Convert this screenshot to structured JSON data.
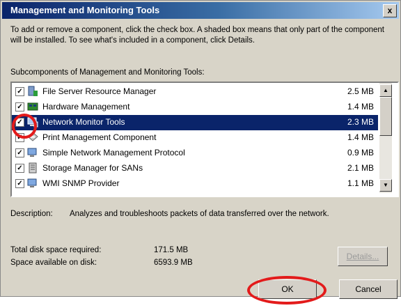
{
  "window": {
    "title": "Management and Monitoring Tools",
    "close_label": "x"
  },
  "intro_text": "To add or remove a component, click the check box. A shaded box means that only part of the component will be installed. To see what's included in a component, click Details.",
  "list_label": "Subcomponents of Management and Monitoring Tools:",
  "components": [
    {
      "name": "File Server Resource Manager",
      "size": "2.5 MB",
      "checked": true,
      "selected": false,
      "icon": "server-icon"
    },
    {
      "name": "Hardware Management",
      "size": "1.4 MB",
      "checked": true,
      "selected": false,
      "icon": "hardware-icon"
    },
    {
      "name": "Network Monitor Tools",
      "size": "2.3 MB",
      "checked": true,
      "selected": true,
      "icon": "network-monitor-icon"
    },
    {
      "name": "Print Management Component",
      "size": "1.4 MB",
      "checked": true,
      "selected": false,
      "icon": "printer-icon"
    },
    {
      "name": "Simple Network Management Protocol",
      "size": "0.9 MB",
      "checked": true,
      "selected": false,
      "icon": "computer-icon"
    },
    {
      "name": "Storage Manager for SANs",
      "size": "2.1 MB",
      "checked": true,
      "selected": false,
      "icon": "storage-icon"
    },
    {
      "name": "WMI SNMP Provider",
      "size": "1.1 MB",
      "checked": true,
      "selected": false,
      "icon": "computer-icon"
    }
  ],
  "description": {
    "label": "Description:",
    "text": "Analyzes and troubleshoots packets of data transferred over the network."
  },
  "disk": {
    "total_label": "Total disk space required:",
    "total_value": "171.5 MB",
    "available_label": "Space available on disk:",
    "available_value": "6593.9 MB"
  },
  "buttons": {
    "details": "Details...",
    "ok": "OK",
    "cancel": "Cancel"
  },
  "colors": {
    "title_bar": "#0a246a",
    "selection": "#0a246a",
    "highlight_circle": "#e31b1b"
  }
}
